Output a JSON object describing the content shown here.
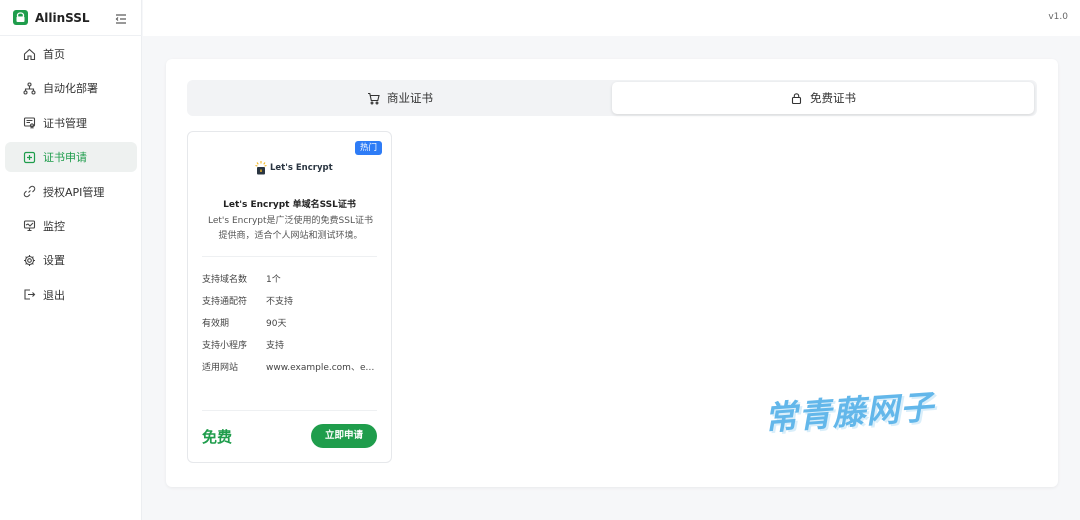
{
  "app": {
    "name": "AllinSSL",
    "version": "v1.0"
  },
  "sidebar": {
    "items": [
      {
        "label": "首页",
        "icon": "home-icon"
      },
      {
        "label": "自动化部署",
        "icon": "workflow-icon"
      },
      {
        "label": "证书管理",
        "icon": "certificate-icon"
      },
      {
        "label": "证书申请",
        "icon": "plus-square-icon",
        "active": true
      },
      {
        "label": "授权API管理",
        "icon": "link-icon"
      },
      {
        "label": "监控",
        "icon": "monitor-icon"
      },
      {
        "label": "设置",
        "icon": "gear-icon"
      },
      {
        "label": "退出",
        "icon": "logout-icon"
      }
    ]
  },
  "tabs": [
    {
      "label": "商业证书",
      "icon": "cart-icon"
    },
    {
      "label": "免费证书",
      "icon": "lock-icon",
      "active": true
    }
  ],
  "cert_card": {
    "badge": "热门",
    "logo_text": "Let's Encrypt",
    "title": "Let's Encrypt 单域名SSL证书",
    "description": "Let's Encrypt是广泛使用的免费SSL证书提供商，适合个人网站和测试环境。",
    "specs": [
      {
        "key": "支持域名数",
        "value": "1个"
      },
      {
        "key": "支持通配符",
        "value": "不支持"
      },
      {
        "key": "有效期",
        "value": "90天"
      },
      {
        "key": "支持小程序",
        "value": "支持"
      },
      {
        "key": "适用网站",
        "value": "www.example.com、ex..."
      }
    ],
    "price": "免费",
    "apply_label": "立即申请"
  },
  "watermark": "常青藤网子",
  "colors": {
    "accent": "#1f9d4c",
    "badge": "#2e7cf6",
    "watermark": "#63b7ea"
  }
}
